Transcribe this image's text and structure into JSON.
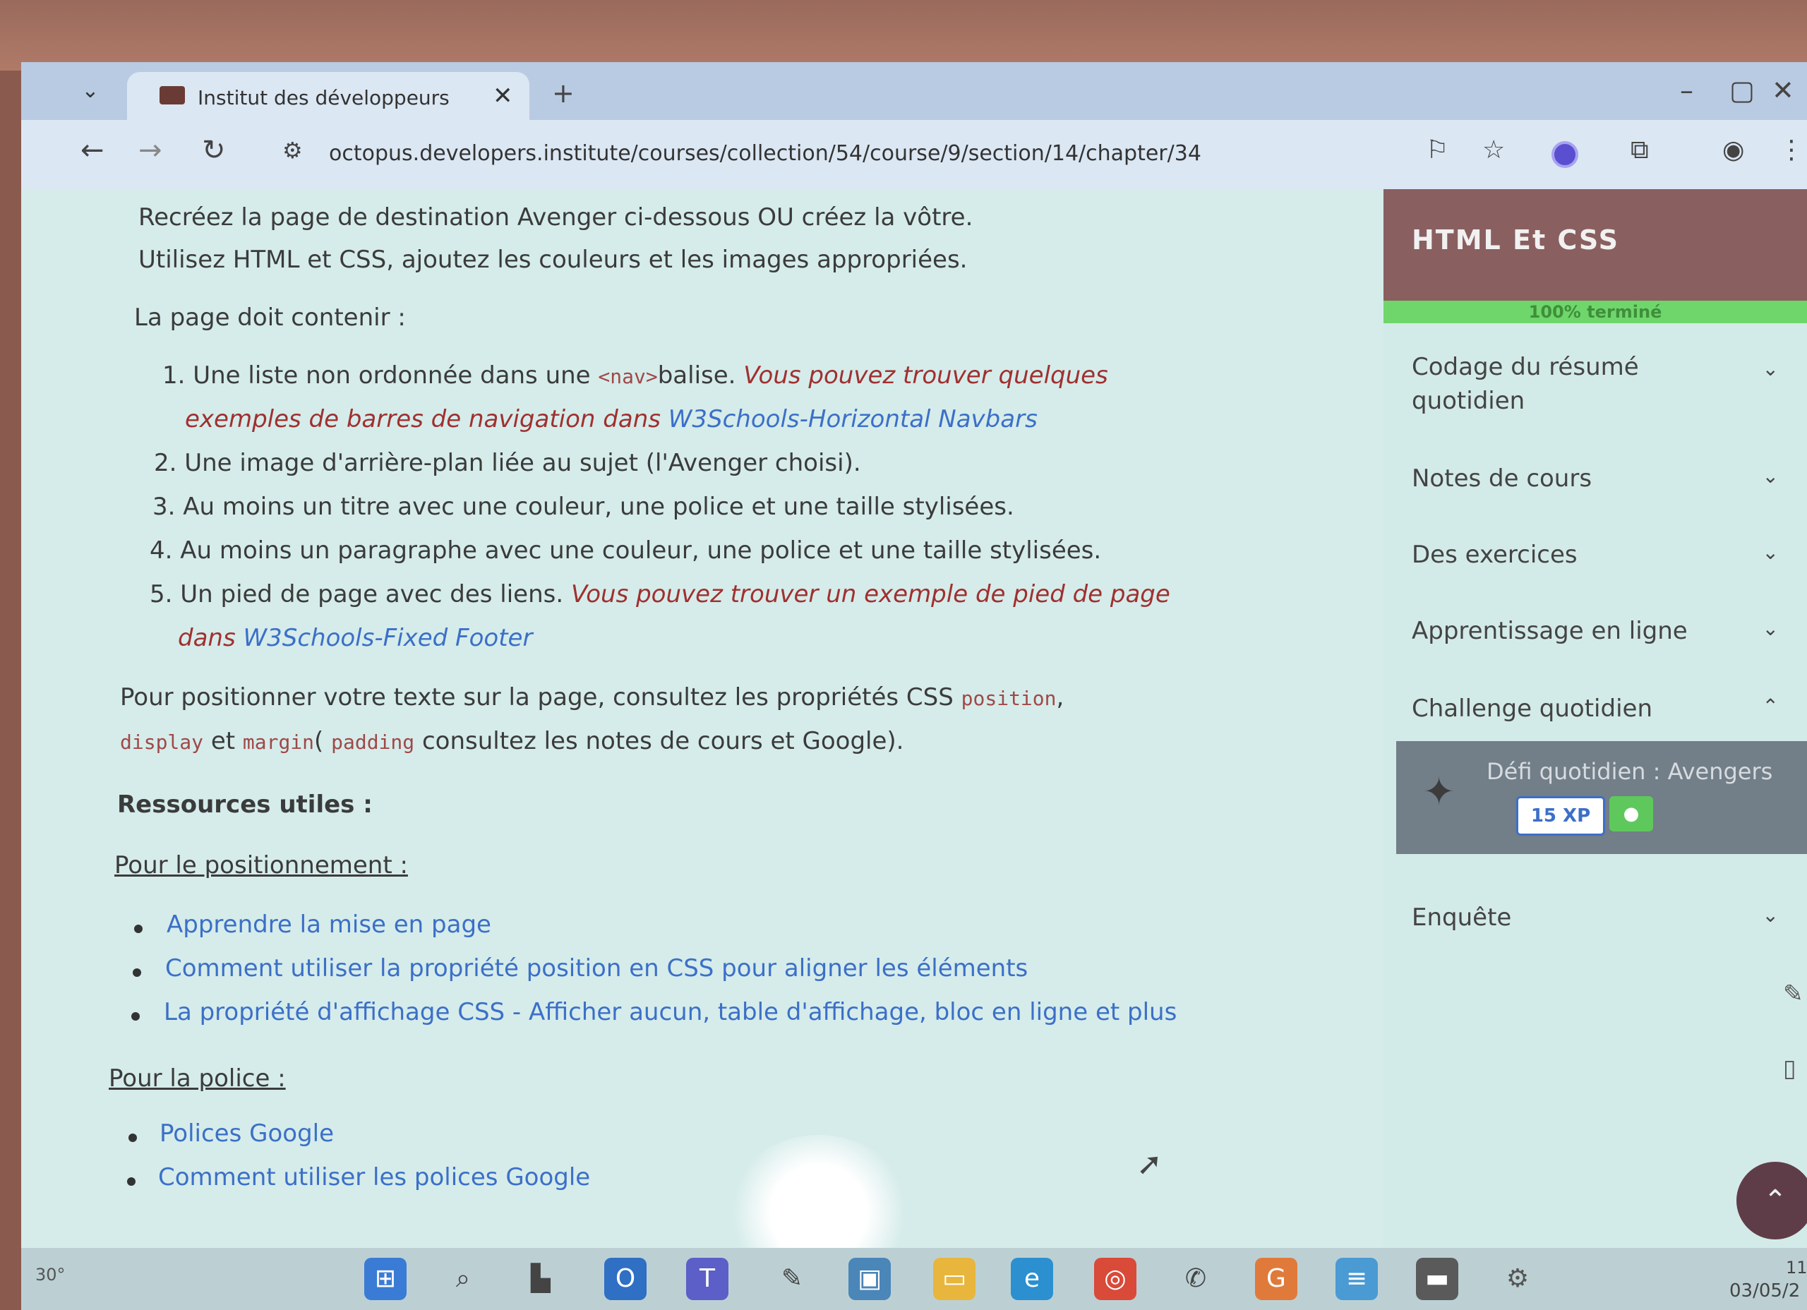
{
  "browser": {
    "tab_title": "Institut des développeurs",
    "tab_close": "✕",
    "new_tab": "+",
    "url": "octopus.developers.institute/courses/collection/54/course/9/section/14/chapter/34"
  },
  "instructions": {
    "line1": "Recréez la page de destination Avenger ci-dessous OU créez la vôtre.",
    "line2": "Utilisez HTML et CSS, ajoutez les couleurs et les images appropriées.",
    "must_contain": "La page doit contenir :",
    "item1_a": "1. Une liste non ordonnée dans une ",
    "item1_code": "<nav>",
    "item1_b": "balise. ",
    "item1_italic": "Vous pouvez trouver quelques",
    "item1_line2": "exemples de barres de navigation dans ",
    "item1_link": "W3Schools-Horizontal Navbars",
    "item2": "2. Une image d'arrière-plan liée au sujet (l'Avenger choisi).",
    "item3": "3. Au moins un titre avec une couleur, une police et une taille stylisées.",
    "item4": "4. Au moins un paragraphe avec une couleur, une police et une taille stylisées.",
    "item5_a": "5. Un pied de page avec des liens. ",
    "item5_italic": "Vous pouvez trouver un exemple de pied de page",
    "item5_line2": "dans ",
    "item5_link": "W3Schools-Fixed Footer",
    "position_a": "Pour  positionner  votre  texte  sur  la  page,  consultez  les  propriétés  CSS  ",
    "position_code1": "position",
    "position_comma": ",",
    "position_code2": "display",
    "position_et": " et ",
    "position_code3": "margin",
    "position_paren": "( ",
    "position_code4": "padding",
    "position_tail": " consultez les notes de cours et Google)."
  },
  "resources": {
    "heading": "Ressources utiles :",
    "positioning_heading": "Pour le positionnement :",
    "positioning_links": [
      "Apprendre la mise en page",
      "Comment utiliser la propriété position en CSS pour aligner les éléments",
      "La propriété d'affichage CSS - Afficher aucun, table d'affichage, bloc en ligne et plus"
    ],
    "font_heading": "Pour la police :",
    "font_links": [
      "Polices Google",
      "Comment utiliser les polices Google"
    ]
  },
  "sidebar": {
    "course_title": "HTML Et CSS",
    "progress_label": "100% terminé",
    "progress_fraction": 1.0,
    "items": [
      {
        "label": "Codage du résumé",
        "label2": "quotidien"
      },
      {
        "label": "Notes de cours"
      },
      {
        "label": "Des exercices"
      },
      {
        "label": "Apprentissage en ligne"
      },
      {
        "label": "Challenge quotidien"
      },
      {
        "label": "Enquête"
      }
    ],
    "daily_challenge": {
      "title": "Défi quotidien : Avengers",
      "xp": "15 XP"
    }
  },
  "taskbar": {
    "temperature": "30°",
    "time": "11",
    "date": "03/05/2"
  },
  "colors": {
    "course_header": "#8a5f60",
    "progress": "#6fd66c",
    "link": "#3c6fc8",
    "emphasis": "#a03030"
  }
}
